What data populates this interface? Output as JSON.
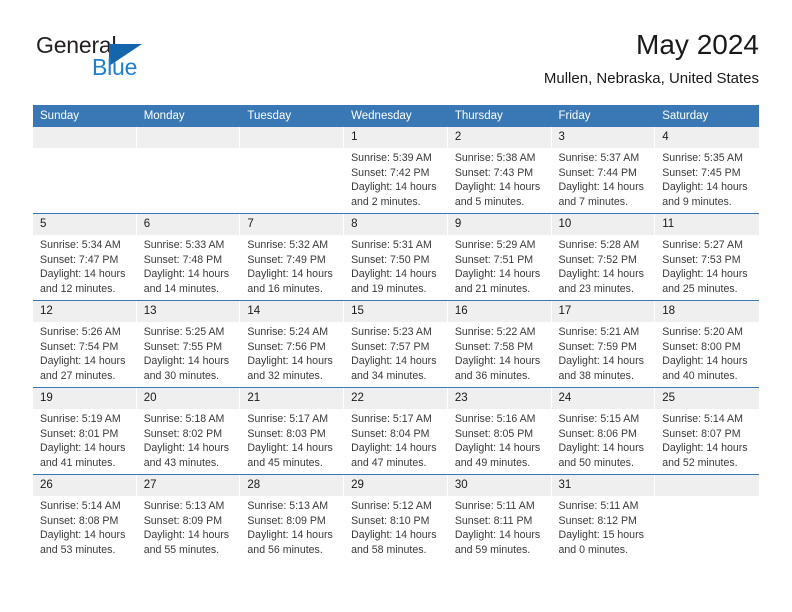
{
  "brand": {
    "name_part1": "General",
    "name_part2": "Blue",
    "triangle_icon": "triangle-logo-icon"
  },
  "header": {
    "title": "May 2024",
    "subtitle": "Mullen, Nebraska, United States"
  },
  "colors": {
    "header_blue": "#3a78b5",
    "logo_blue": "#1c7fd0",
    "date_band_gray": "#efefef",
    "text_dark": "#1a1a1a",
    "text_body": "#3a3a3a"
  },
  "weekday_headers": [
    "Sunday",
    "Monday",
    "Tuesday",
    "Wednesday",
    "Thursday",
    "Friday",
    "Saturday"
  ],
  "labels": {
    "sunrise": "Sunrise:",
    "sunset": "Sunset:",
    "daylight": "Daylight:"
  },
  "weeks": [
    [
      {
        "day": "",
        "empty": true
      },
      {
        "day": "",
        "empty": true
      },
      {
        "day": "",
        "empty": true
      },
      {
        "day": "1",
        "sunrise": "Sunrise: 5:39 AM",
        "sunset": "Sunset: 7:42 PM",
        "daylight": "Daylight: 14 hours and 2 minutes."
      },
      {
        "day": "2",
        "sunrise": "Sunrise: 5:38 AM",
        "sunset": "Sunset: 7:43 PM",
        "daylight": "Daylight: 14 hours and 5 minutes."
      },
      {
        "day": "3",
        "sunrise": "Sunrise: 5:37 AM",
        "sunset": "Sunset: 7:44 PM",
        "daylight": "Daylight: 14 hours and 7 minutes."
      },
      {
        "day": "4",
        "sunrise": "Sunrise: 5:35 AM",
        "sunset": "Sunset: 7:45 PM",
        "daylight": "Daylight: 14 hours and 9 minutes."
      }
    ],
    [
      {
        "day": "5",
        "sunrise": "Sunrise: 5:34 AM",
        "sunset": "Sunset: 7:47 PM",
        "daylight": "Daylight: 14 hours and 12 minutes."
      },
      {
        "day": "6",
        "sunrise": "Sunrise: 5:33 AM",
        "sunset": "Sunset: 7:48 PM",
        "daylight": "Daylight: 14 hours and 14 minutes."
      },
      {
        "day": "7",
        "sunrise": "Sunrise: 5:32 AM",
        "sunset": "Sunset: 7:49 PM",
        "daylight": "Daylight: 14 hours and 16 minutes."
      },
      {
        "day": "8",
        "sunrise": "Sunrise: 5:31 AM",
        "sunset": "Sunset: 7:50 PM",
        "daylight": "Daylight: 14 hours and 19 minutes."
      },
      {
        "day": "9",
        "sunrise": "Sunrise: 5:29 AM",
        "sunset": "Sunset: 7:51 PM",
        "daylight": "Daylight: 14 hours and 21 minutes."
      },
      {
        "day": "10",
        "sunrise": "Sunrise: 5:28 AM",
        "sunset": "Sunset: 7:52 PM",
        "daylight": "Daylight: 14 hours and 23 minutes."
      },
      {
        "day": "11",
        "sunrise": "Sunrise: 5:27 AM",
        "sunset": "Sunset: 7:53 PM",
        "daylight": "Daylight: 14 hours and 25 minutes."
      }
    ],
    [
      {
        "day": "12",
        "sunrise": "Sunrise: 5:26 AM",
        "sunset": "Sunset: 7:54 PM",
        "daylight": "Daylight: 14 hours and 27 minutes."
      },
      {
        "day": "13",
        "sunrise": "Sunrise: 5:25 AM",
        "sunset": "Sunset: 7:55 PM",
        "daylight": "Daylight: 14 hours and 30 minutes."
      },
      {
        "day": "14",
        "sunrise": "Sunrise: 5:24 AM",
        "sunset": "Sunset: 7:56 PM",
        "daylight": "Daylight: 14 hours and 32 minutes."
      },
      {
        "day": "15",
        "sunrise": "Sunrise: 5:23 AM",
        "sunset": "Sunset: 7:57 PM",
        "daylight": "Daylight: 14 hours and 34 minutes."
      },
      {
        "day": "16",
        "sunrise": "Sunrise: 5:22 AM",
        "sunset": "Sunset: 7:58 PM",
        "daylight": "Daylight: 14 hours and 36 minutes."
      },
      {
        "day": "17",
        "sunrise": "Sunrise: 5:21 AM",
        "sunset": "Sunset: 7:59 PM",
        "daylight": "Daylight: 14 hours and 38 minutes."
      },
      {
        "day": "18",
        "sunrise": "Sunrise: 5:20 AM",
        "sunset": "Sunset: 8:00 PM",
        "daylight": "Daylight: 14 hours and 40 minutes."
      }
    ],
    [
      {
        "day": "19",
        "sunrise": "Sunrise: 5:19 AM",
        "sunset": "Sunset: 8:01 PM",
        "daylight": "Daylight: 14 hours and 41 minutes."
      },
      {
        "day": "20",
        "sunrise": "Sunrise: 5:18 AM",
        "sunset": "Sunset: 8:02 PM",
        "daylight": "Daylight: 14 hours and 43 minutes."
      },
      {
        "day": "21",
        "sunrise": "Sunrise: 5:17 AM",
        "sunset": "Sunset: 8:03 PM",
        "daylight": "Daylight: 14 hours and 45 minutes."
      },
      {
        "day": "22",
        "sunrise": "Sunrise: 5:17 AM",
        "sunset": "Sunset: 8:04 PM",
        "daylight": "Daylight: 14 hours and 47 minutes."
      },
      {
        "day": "23",
        "sunrise": "Sunrise: 5:16 AM",
        "sunset": "Sunset: 8:05 PM",
        "daylight": "Daylight: 14 hours and 49 minutes."
      },
      {
        "day": "24",
        "sunrise": "Sunrise: 5:15 AM",
        "sunset": "Sunset: 8:06 PM",
        "daylight": "Daylight: 14 hours and 50 minutes."
      },
      {
        "day": "25",
        "sunrise": "Sunrise: 5:14 AM",
        "sunset": "Sunset: 8:07 PM",
        "daylight": "Daylight: 14 hours and 52 minutes."
      }
    ],
    [
      {
        "day": "26",
        "sunrise": "Sunrise: 5:14 AM",
        "sunset": "Sunset: 8:08 PM",
        "daylight": "Daylight: 14 hours and 53 minutes."
      },
      {
        "day": "27",
        "sunrise": "Sunrise: 5:13 AM",
        "sunset": "Sunset: 8:09 PM",
        "daylight": "Daylight: 14 hours and 55 minutes."
      },
      {
        "day": "28",
        "sunrise": "Sunrise: 5:13 AM",
        "sunset": "Sunset: 8:09 PM",
        "daylight": "Daylight: 14 hours and 56 minutes."
      },
      {
        "day": "29",
        "sunrise": "Sunrise: 5:12 AM",
        "sunset": "Sunset: 8:10 PM",
        "daylight": "Daylight: 14 hours and 58 minutes."
      },
      {
        "day": "30",
        "sunrise": "Sunrise: 5:11 AM",
        "sunset": "Sunset: 8:11 PM",
        "daylight": "Daylight: 14 hours and 59 minutes."
      },
      {
        "day": "31",
        "sunrise": "Sunrise: 5:11 AM",
        "sunset": "Sunset: 8:12 PM",
        "daylight": "Daylight: 15 hours and 0 minutes."
      },
      {
        "day": "",
        "empty": true
      }
    ]
  ]
}
